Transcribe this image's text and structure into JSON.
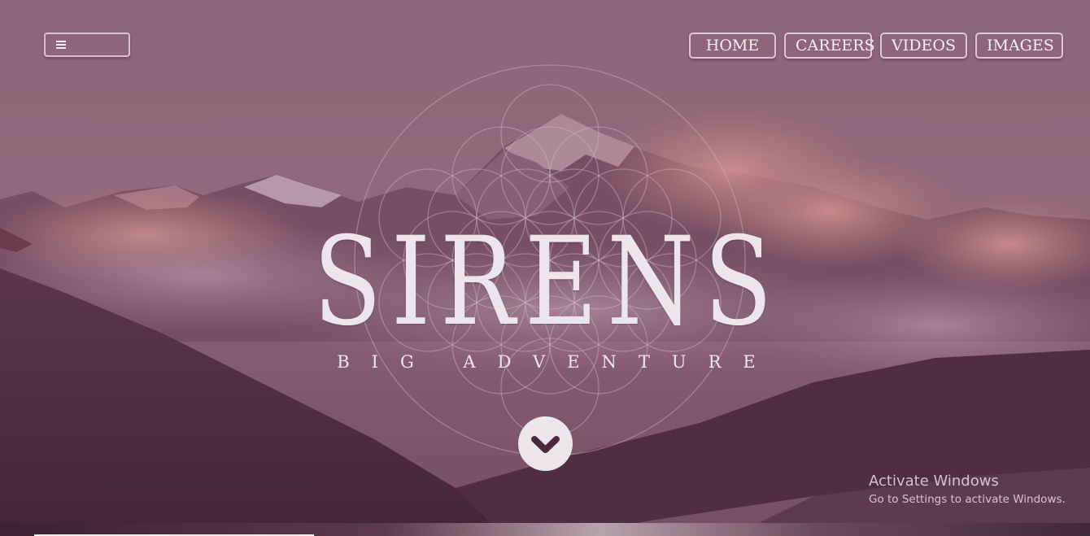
{
  "menu": {
    "icon": "hamburger-menu-icon"
  },
  "nav": {
    "items": [
      {
        "label": "HOME"
      },
      {
        "label": "CAREERS"
      },
      {
        "label": "VIDEOS"
      },
      {
        "label": "IMAGES"
      }
    ]
  },
  "hero": {
    "title": "SIRENS",
    "subtitle": "BIG ADVENTURE",
    "scroll_icon": "chevron-down-circle-icon",
    "background": "mountain-landscape-image",
    "emblem": "flower-of-life-pattern"
  },
  "watermark": {
    "title": "Activate Windows",
    "subtitle": "Go to Settings to activate Windows."
  },
  "colors": {
    "overlay": "#8a5f73",
    "text": "#ece6ea",
    "sky": "#9a7382"
  }
}
